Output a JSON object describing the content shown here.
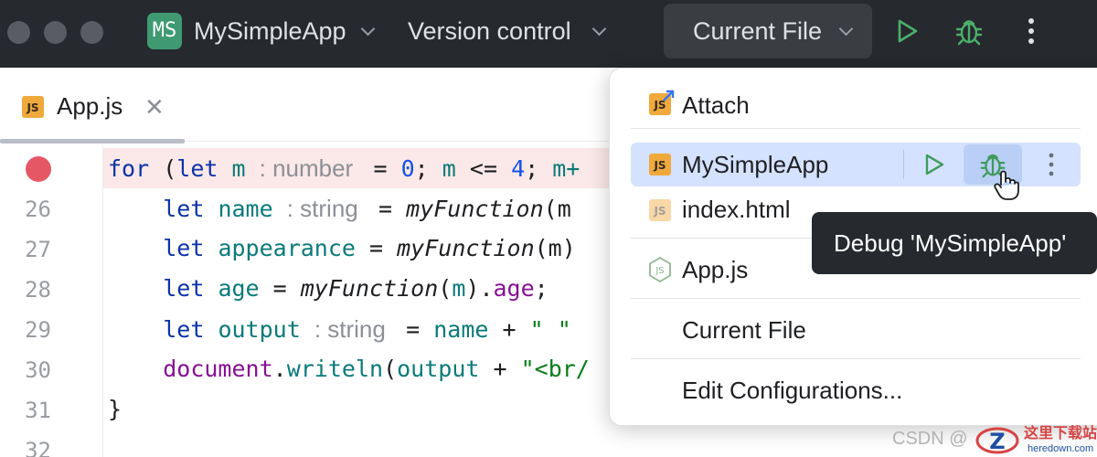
{
  "titlebar": {
    "project_badge": "MS",
    "project_name": "MySimpleApp",
    "vcs_label": "Version control",
    "run_config": "Current File",
    "icons": [
      "run-icon",
      "debug-icon",
      "more-vertical-icon"
    ]
  },
  "editor": {
    "tab_label": "App.js",
    "tab_icon": "JS",
    "line_numbers": [
      "26",
      "27",
      "28",
      "29",
      "30",
      "31",
      "32"
    ],
    "code": {
      "l25": {
        "kw1": "for",
        "p1": " (",
        "kw2": "let",
        "sp": " ",
        "v1": "m",
        "hint": "number",
        "p2": " = ",
        "n1": "0",
        "p3": "; ",
        "v2": "m",
        "p4": " <= ",
        "n2": "4",
        "p5": "; ",
        "v3": "m+"
      },
      "l26": {
        "kw": "let",
        "v": "name",
        "hint": "string",
        "p1": " = ",
        "fn": "myFunction",
        "p2": "(m"
      },
      "l27": {
        "kw": "let",
        "v": "appearance",
        "p1": " = ",
        "fn": "myFunction",
        "p2": "(m)"
      },
      "l28": {
        "kw": "let",
        "v": "age",
        "p1": " = ",
        "fn": "myFunction",
        "p2": "(",
        "a": "m",
        "p3": ").",
        "prop": "age",
        "p4": ";"
      },
      "l29": {
        "kw": "let",
        "v": "output",
        "hint": "string",
        "p1": " = ",
        "v2": "name",
        "p2": " + ",
        "s": "\" \""
      },
      "l30": {
        "obj": "document",
        "p1": ".",
        "m": "writeln",
        "p2": "(",
        "v": "output",
        "p3": " + ",
        "s": "\"<br/"
      },
      "l31": {
        "p": "}"
      }
    }
  },
  "popup": {
    "items": [
      {
        "label": "Attach",
        "icon": "JS"
      },
      {
        "label": "MySimpleApp",
        "icon": "JS"
      },
      {
        "label": "index.html",
        "icon": "JS"
      },
      {
        "label": "App.js",
        "icon": "nodejs-icon"
      },
      {
        "label": "Current File"
      },
      {
        "label": "Edit Configurations..."
      }
    ],
    "tooltip": "Debug 'MySimpleApp'"
  },
  "watermark": {
    "csdn": "CSDN @",
    "site_cn": "这里下载站",
    "site_url": "heredown.com"
  },
  "colors": {
    "titlebar_bg": "#26292e",
    "project_badge": "#3f9a72",
    "run_green": "#4caf6a",
    "breakpoint": "#e55765",
    "selection": "#d4e2ff",
    "js_icon": "#f0a93b"
  }
}
